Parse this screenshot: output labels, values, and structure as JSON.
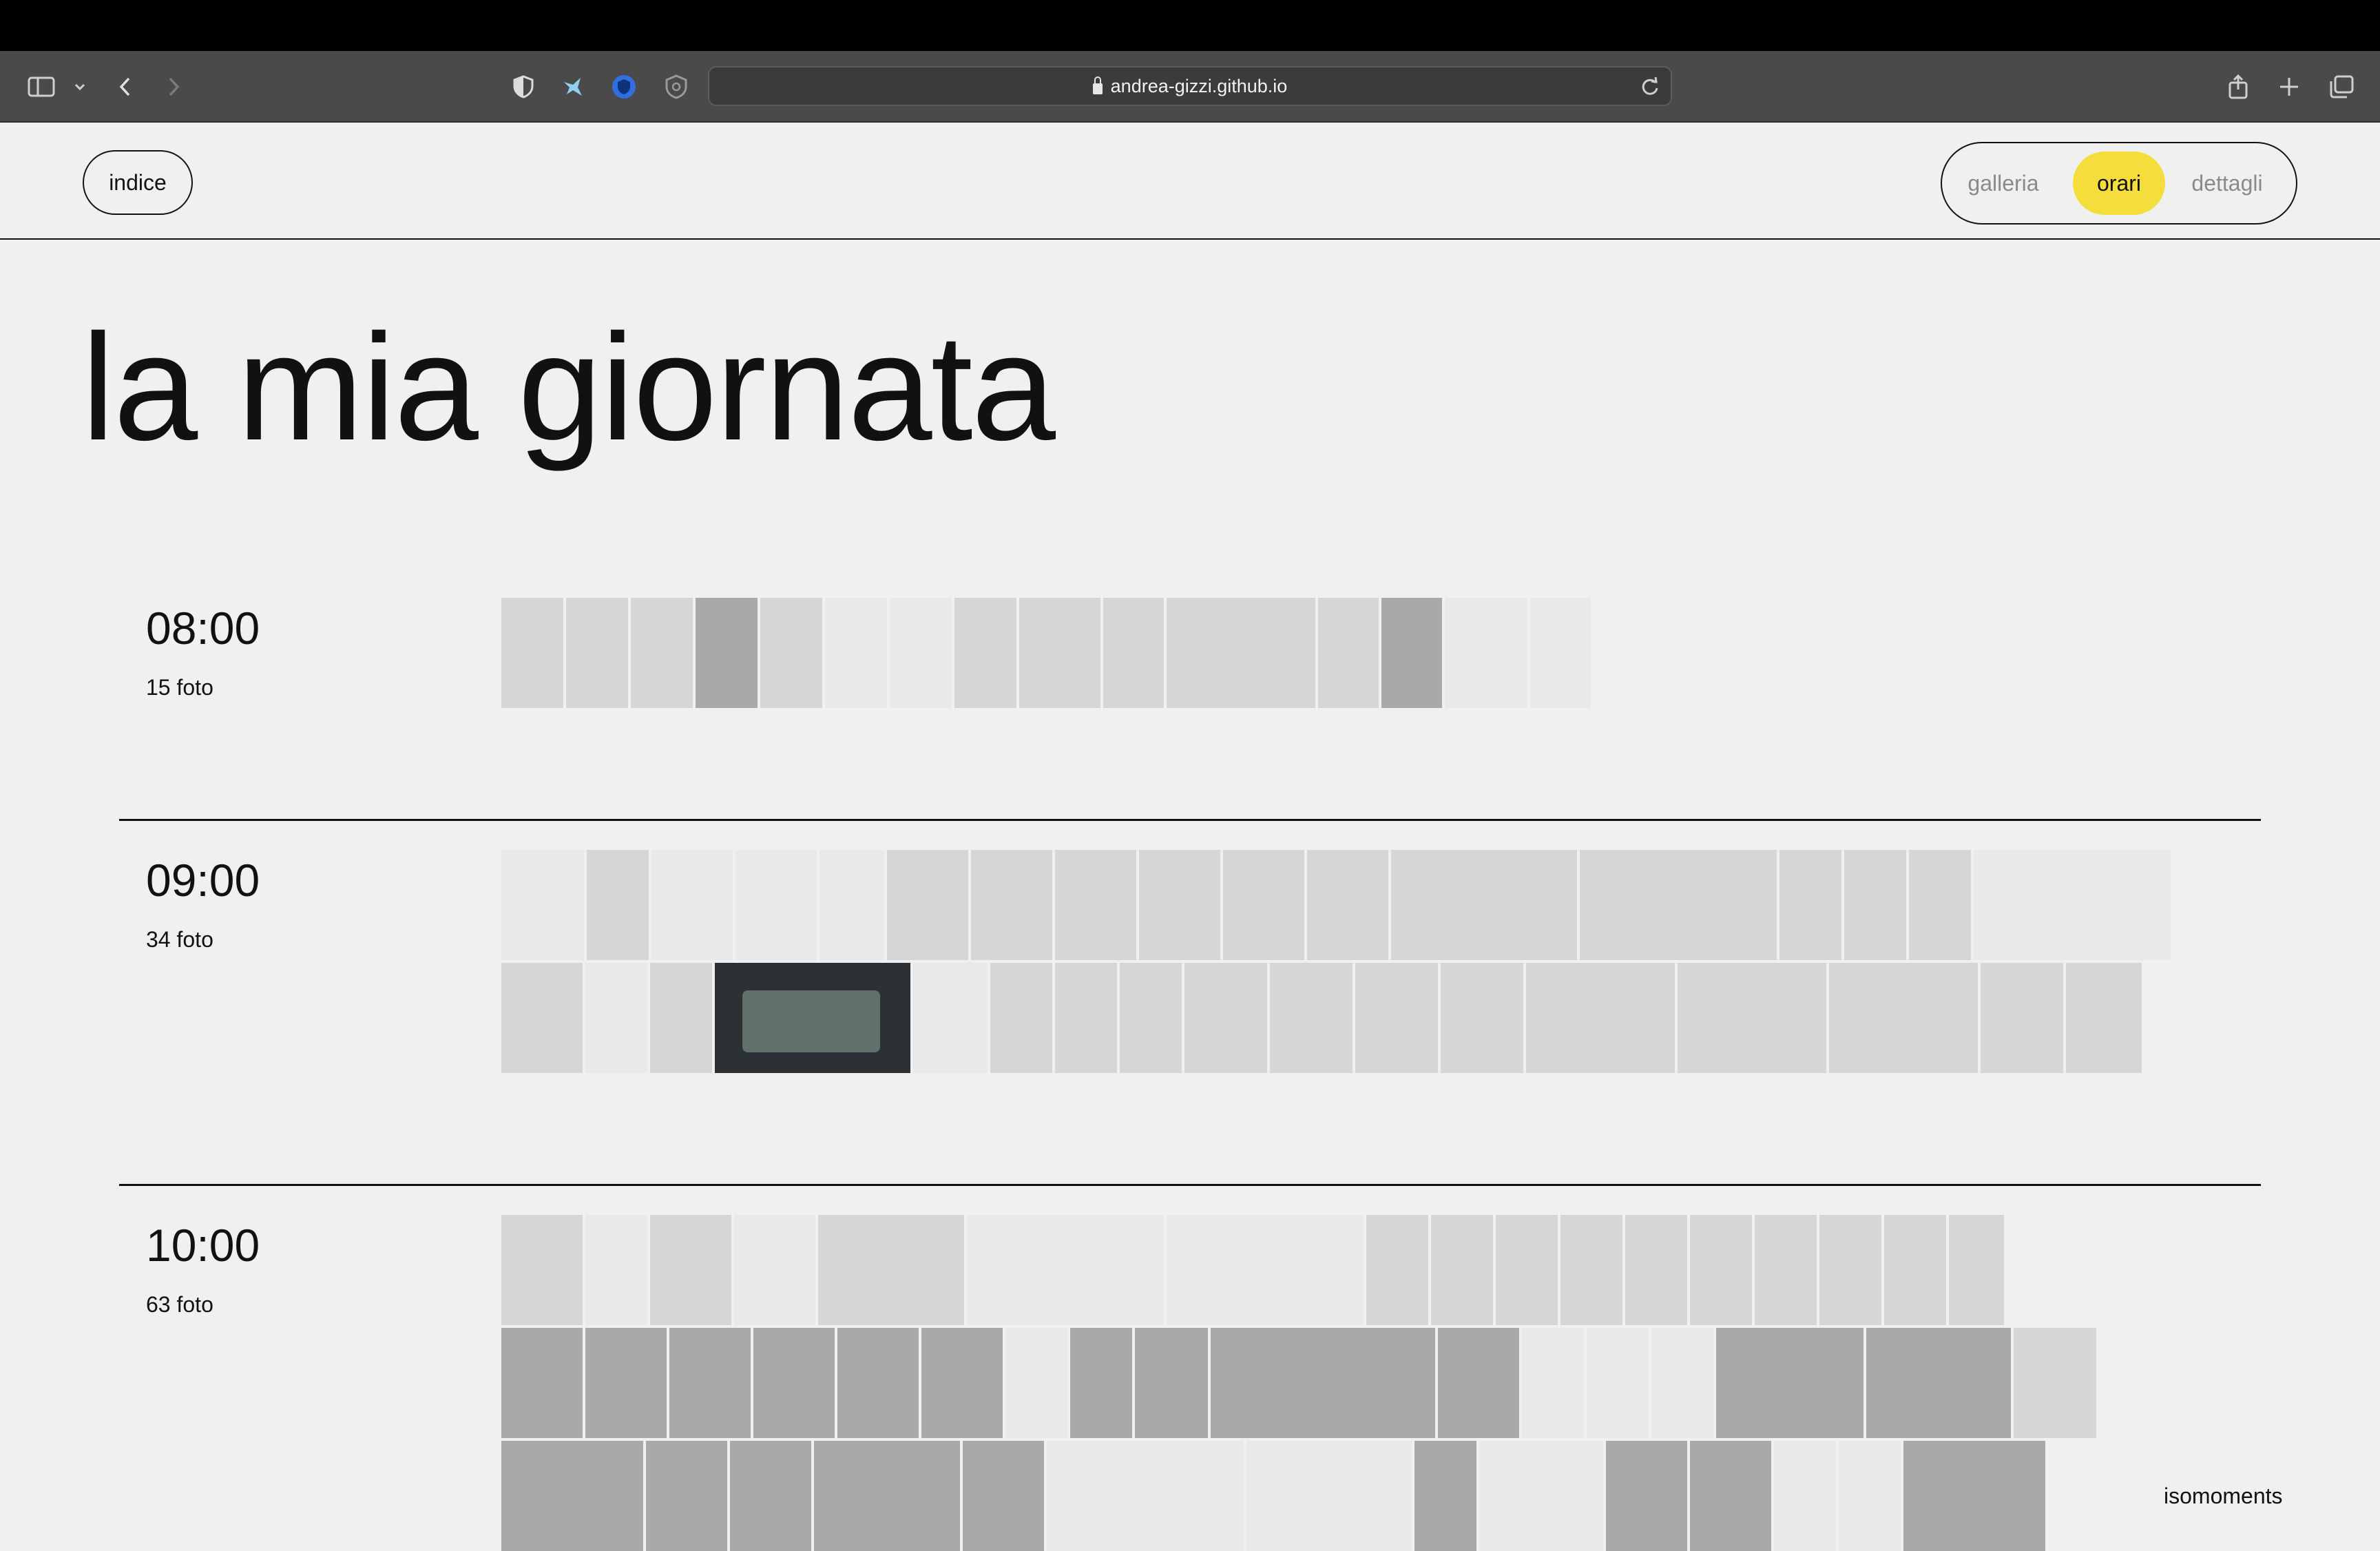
{
  "browser": {
    "url": "andrea-gizzi.github.io"
  },
  "nav": {
    "home_label": "indice",
    "tabs": [
      {
        "label": "galleria",
        "active": false
      },
      {
        "label": "orari",
        "active": true
      },
      {
        "label": "dettagli",
        "active": false
      }
    ]
  },
  "page": {
    "title": "la mia giornata"
  },
  "sections": [
    {
      "time": "08:00",
      "count": "15 foto"
    },
    {
      "time": "09:00",
      "count": "34 foto"
    },
    {
      "time": "10:00",
      "count": "63 foto"
    }
  ],
  "footer": {
    "brand": "isomoments"
  },
  "colors": {
    "accent": "#f5dd3c",
    "background": "#f0f0f0",
    "text": "#111111"
  }
}
